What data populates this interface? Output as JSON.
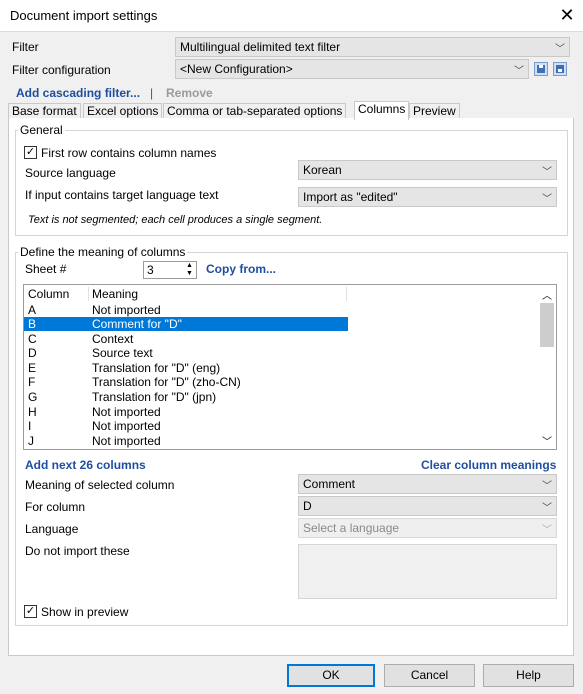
{
  "window": {
    "title": "Document import settings"
  },
  "filter": {
    "label": "Filter",
    "value": "Multilingual delimited text filter",
    "config_label": "Filter configuration",
    "config_value": "<New Configuration>"
  },
  "links": {
    "add_cascading": "Add cascading filter...",
    "separator": "|",
    "remove": "Remove"
  },
  "tabs": [
    "Base format",
    "Excel options",
    "Comma or tab-separated options",
    "Columns",
    "Preview"
  ],
  "general": {
    "title": "General",
    "first_row_label": "First row contains column names",
    "first_row_checked": true,
    "source_language_label": "Source language",
    "source_language_value": "Korean",
    "target_text_label": "If input contains target language text",
    "target_text_value": "Import as \"edited\"",
    "note": "Text is not segmented; each cell produces a single segment."
  },
  "columns_group": {
    "title": "Define the meaning of columns",
    "sheet_label": "Sheet #",
    "sheet_value": "3",
    "copy_from": "Copy from...",
    "headers": {
      "column": "Column",
      "meaning": "Meaning"
    },
    "rows": [
      {
        "column": "A",
        "meaning": "Not imported",
        "selected": false
      },
      {
        "column": "B",
        "meaning": "Comment for \"D\"",
        "selected": true
      },
      {
        "column": "C",
        "meaning": "Context",
        "selected": false
      },
      {
        "column": "D",
        "meaning": "Source text",
        "selected": false
      },
      {
        "column": "E",
        "meaning": "Translation for \"D\" (eng)",
        "selected": false
      },
      {
        "column": "F",
        "meaning": "Translation for \"D\" (zho-CN)",
        "selected": false
      },
      {
        "column": "G",
        "meaning": "Translation for \"D\" (jpn)",
        "selected": false
      },
      {
        "column": "H",
        "meaning": "Not imported",
        "selected": false
      },
      {
        "column": "I",
        "meaning": "Not imported",
        "selected": false
      },
      {
        "column": "J",
        "meaning": "Not imported",
        "selected": false
      }
    ],
    "add_next": "Add next 26 columns",
    "clear_meanings": "Clear column meanings",
    "meaning_label": "Meaning of selected column",
    "meaning_value": "Comment",
    "for_column_label": "For column",
    "for_column_value": "D",
    "language_label": "Language",
    "language_placeholder": "Select a language",
    "do_not_import_label": "Do not import these",
    "show_preview_label": "Show in preview",
    "show_preview_checked": true
  },
  "buttons": {
    "ok": "OK",
    "cancel": "Cancel",
    "help": "Help"
  },
  "colors": {
    "accent": "#0078d7",
    "link": "#1f4e9f",
    "window_bg": "#f0f0f0"
  },
  "icons": [
    "close-icon",
    "chevron-down-icon",
    "save-config-icon",
    "save-as-config-icon",
    "checkmark-icon",
    "spin-up-icon",
    "spin-down-icon",
    "scroll-up-icon",
    "scroll-down-icon"
  ]
}
